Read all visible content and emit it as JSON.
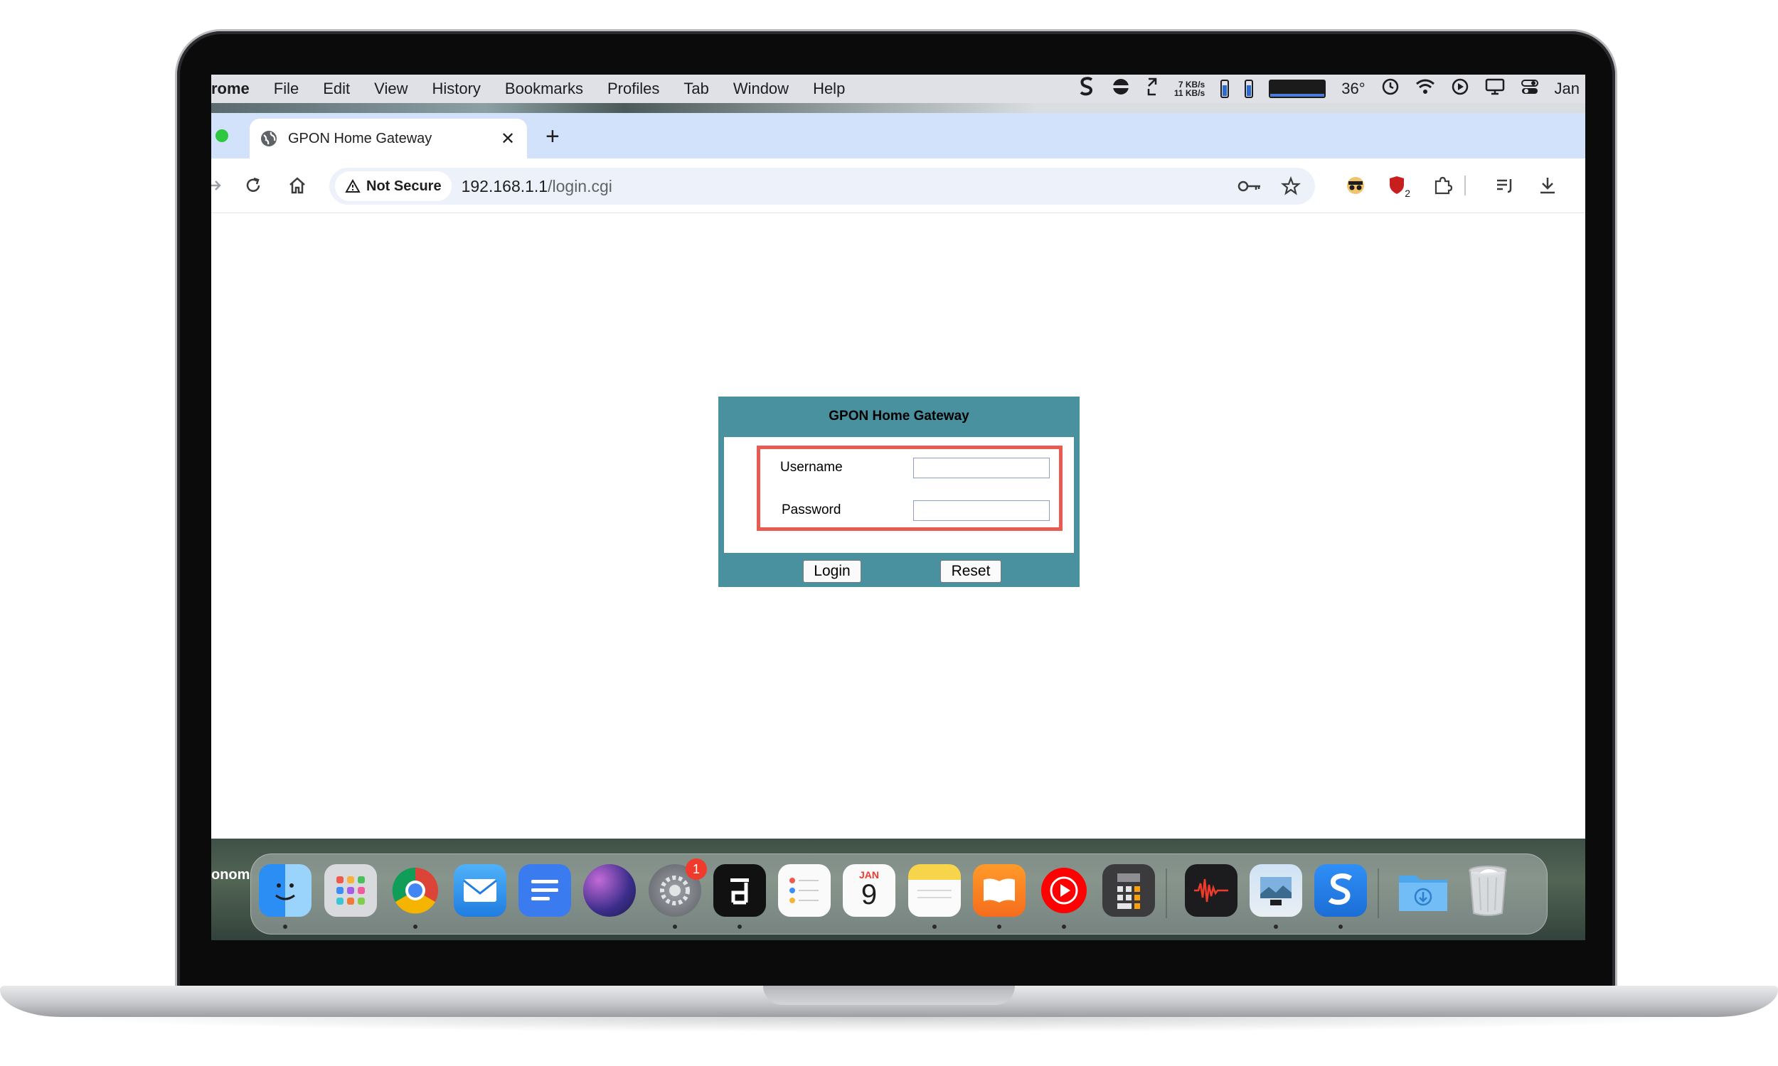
{
  "menubar": {
    "app": "rome",
    "items": [
      "File",
      "Edit",
      "View",
      "History",
      "Bookmarks",
      "Profiles",
      "Tab",
      "Window",
      "Help"
    ],
    "net_up": "7 KB/s",
    "net_down": "11 KB/s",
    "temp": "36°",
    "date": "Jan"
  },
  "browser": {
    "tab_title": "GPON Home Gateway",
    "new_tab": "+",
    "not_secure": "Not Secure",
    "url_host": "192.168.1.1",
    "url_path": "/login.cgi",
    "extension_badge": "2"
  },
  "login": {
    "title": "GPON Home Gateway",
    "username_label": "Username",
    "password_label": "Password",
    "username_value": "",
    "password_value": "",
    "login_button": "Login",
    "reset_button": "Reset"
  },
  "dock": {
    "left_label": "onom",
    "settings_badge": "1",
    "calendar_month": "JAN",
    "calendar_day": "9"
  },
  "colors": {
    "login_panel": "#4a919f",
    "highlight": "#eb5a51",
    "tabstrip": "#d3e2fb"
  }
}
